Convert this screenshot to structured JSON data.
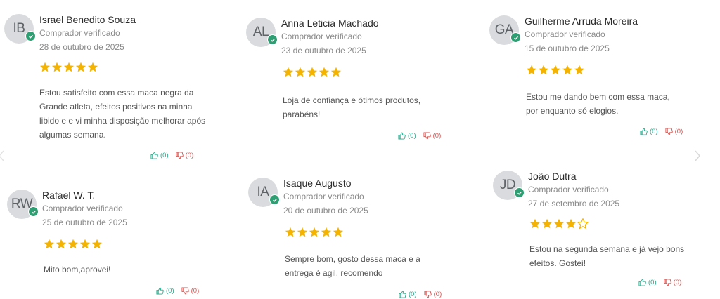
{
  "reviews": [
    {
      "initials": "IB",
      "name": "Israel Benedito Souza",
      "verified": "Comprador verificado",
      "date": "28 de outubro de 2025",
      "rating": 5,
      "text": "Estou satisfeito com essa maca negra da Grande atleta, efeitos positivos na minha libido e e vi minha disposição melhorar após algumas semana.",
      "up": "(0)",
      "down": "(0)"
    },
    {
      "initials": "AL",
      "name": "Anna Leticia Machado",
      "verified": "Comprador verificado",
      "date": "23 de outubro de 2025",
      "rating": 5,
      "text": "Loja de confiança e ótimos produtos, parabéns!",
      "up": "(0)",
      "down": "(0)"
    },
    {
      "initials": "GA",
      "name": "Guilherme Arruda Moreira",
      "verified": "Comprador verificado",
      "date": "15 de outubro de 2025",
      "rating": 5,
      "text": "Estou me dando bem com essa maca, por enquanto só elogios.",
      "up": "(0)",
      "down": "(0)"
    },
    {
      "initials": "RW",
      "name": "Rafael W. T.",
      "verified": "Comprador verificado",
      "date": "25 de outubro de 2025",
      "rating": 5,
      "text": "Mito bom,aprovei!",
      "up": "(0)",
      "down": "(0)"
    },
    {
      "initials": "IA",
      "name": "Isaque Augusto",
      "verified": "Comprador verificado",
      "date": "20 de outubro de 2025",
      "rating": 5,
      "text": "Sempre bom, gosto dessa maca e a entrega é agil. recomendo",
      "up": "(0)",
      "down": "(0)"
    },
    {
      "initials": "JD",
      "name": "João Dutra",
      "verified": "Comprador verificado",
      "date": "27 de setembro de 2025",
      "rating": 4,
      "text": "Estou na segunda semana e já vejo bons efeitos. Gostei!",
      "up": "(0)",
      "down": "(0)"
    }
  ],
  "colors": {
    "star": "#f5b301",
    "verified": "#2f9e73",
    "upvote": "#2aa88a",
    "downvote": "#d9534f"
  },
  "icons": {
    "prev": "chevron-left-icon",
    "next": "chevron-right-icon",
    "up": "thumbs-up-icon",
    "down": "thumbs-down-icon",
    "verified": "check-circle-icon",
    "star": "star-icon"
  }
}
